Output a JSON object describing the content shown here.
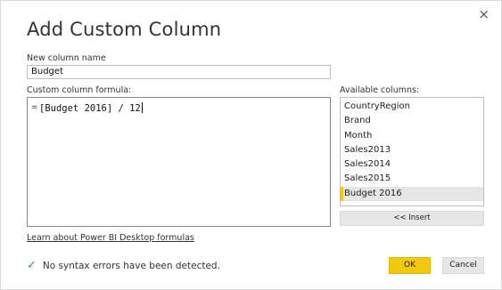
{
  "dialog": {
    "title": "Add Custom Column",
    "close_glyph": "×"
  },
  "name": {
    "label": "New column name",
    "value": "Budget"
  },
  "formula": {
    "label": "Custom column formula:",
    "prefix": "=",
    "value": "[Budget 2016] / 12"
  },
  "columns": {
    "label": "Available columns:",
    "items": [
      "CountryRegion",
      "Brand",
      "Month",
      "Sales2013",
      "Sales2014",
      "Sales2015",
      "Budget 2016"
    ],
    "selected": "Budget 2016",
    "insert_label": "<< Insert"
  },
  "links": {
    "learn": "Learn about Power BI Desktop formulas"
  },
  "status": {
    "icon": "check-icon",
    "message": "No syntax errors have been detected."
  },
  "buttons": {
    "ok": "OK",
    "cancel": "Cancel"
  },
  "colors": {
    "accent": "#f2c811",
    "success": "#2e9a40"
  }
}
